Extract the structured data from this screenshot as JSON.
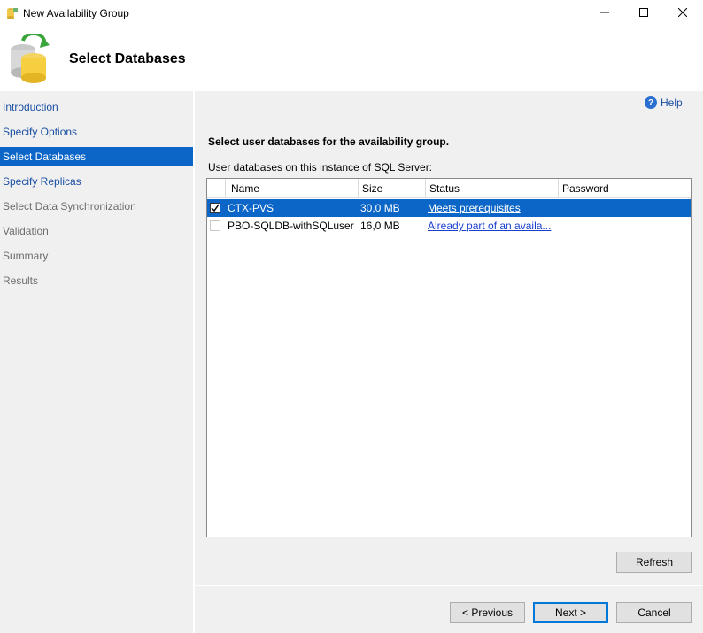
{
  "window": {
    "title": "New Availability Group",
    "icons": {
      "app": "availability-group-icon",
      "minimize": "minimize-icon",
      "maximize": "maximize-icon",
      "close": "close-icon"
    }
  },
  "banner": {
    "title": "Select Databases",
    "icon": "database-sync-icon"
  },
  "sidebar": {
    "items": [
      {
        "label": "Introduction",
        "state": "link"
      },
      {
        "label": "Specify Options",
        "state": "link"
      },
      {
        "label": "Select Databases",
        "state": "selected"
      },
      {
        "label": "Specify Replicas",
        "state": "link"
      },
      {
        "label": "Select Data Synchronization",
        "state": "disabled"
      },
      {
        "label": "Validation",
        "state": "disabled"
      },
      {
        "label": "Summary",
        "state": "disabled"
      },
      {
        "label": "Results",
        "state": "disabled"
      }
    ]
  },
  "main": {
    "help_label": "Help",
    "instruction": "Select user databases for the availability group.",
    "grid_label": "User databases on this instance of SQL Server:",
    "columns": [
      "Name",
      "Size",
      "Status",
      "Password"
    ],
    "rows": [
      {
        "checked": true,
        "name": "CTX-PVS",
        "size": "30,0 MB",
        "status": "Meets prerequisites",
        "password": "",
        "selected": true
      },
      {
        "checked": false,
        "name": "PBO-SQLDB-withSQLuser",
        "size": "16,0 MB",
        "status": "Already part of an availa...",
        "password": "",
        "selected": false
      }
    ],
    "refresh_label": "Refresh"
  },
  "footer": {
    "previous_label": "< Previous",
    "next_label": "Next >",
    "cancel_label": "Cancel"
  },
  "colors": {
    "selection": "#0c66c7",
    "link": "#1a4fa3",
    "panel": "#f0f0f0"
  }
}
